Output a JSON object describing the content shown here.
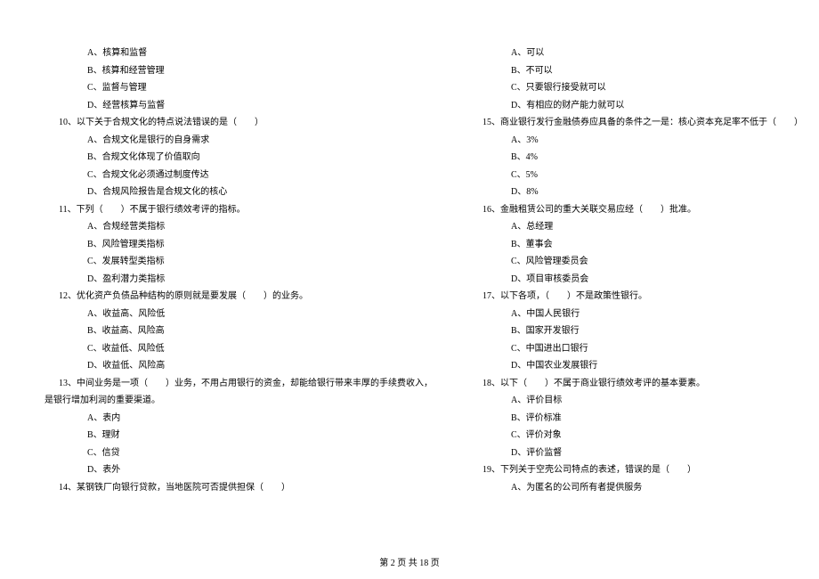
{
  "left": {
    "opts_pre": [
      "A、核算和监督",
      "B、核算和经营管理",
      "C、监督与管理",
      "D、经营核算与监督"
    ],
    "q10": "10、以下关于合规文化的特点说法错误的是（　　）",
    "q10_opts": [
      "A、合规文化是银行的自身需求",
      "B、合规文化体现了价值取向",
      "C、合规文化必须通过制度传达",
      "D、合规风险报告是合规文化的核心"
    ],
    "q11": "11、下列（　　）不属于银行绩效考评的指标。",
    "q11_opts": [
      "A、合规经营类指标",
      "B、风险管理类指标",
      "C、发展转型类指标",
      "D、盈利潜力类指标"
    ],
    "q12": "12、优化资产负债品种结构的原则就是要发展（　　）的业务。",
    "q12_opts": [
      "A、收益高、风险低",
      "B、收益高、风险高",
      "C、收益低、风险低",
      "D、收益低、风险高"
    ],
    "q13_a": "13、中间业务是一项（　　）业务，不用占用银行的资金，却能给银行带来丰厚的手续费收入，",
    "q13_b": "是银行增加利润的重要渠道。",
    "q13_opts": [
      "A、表内",
      "B、理财",
      "C、信贷",
      "D、表外"
    ],
    "q14": "14、某钢铁厂向银行贷款，当地医院可否提供担保（　　）"
  },
  "right": {
    "opts_pre": [
      "A、可以",
      "B、不可以",
      "C、只要银行接受就可以",
      "D、有相应的财产能力就可以"
    ],
    "q15": "15、商业银行发行金融债券应具备的条件之一是：核心资本充足率不低于（　　）",
    "q15_opts": [
      "A、3%",
      "B、4%",
      "C、5%",
      "D、8%"
    ],
    "q16": "16、金融租赁公司的重大关联交易应经（　　）批准。",
    "q16_opts": [
      "A、总经理",
      "B、董事会",
      "C、风险管理委员会",
      "D、项目审核委员会"
    ],
    "q17": "17、以下各项，（　　）不是政策性银行。",
    "q17_opts": [
      "A、中国人民银行",
      "B、国家开发银行",
      "C、中国进出口银行",
      "D、中国农业发展银行"
    ],
    "q18": "18、以下（　　）不属于商业银行绩效考评的基本要素。",
    "q18_opts": [
      "A、评价目标",
      "B、评价标准",
      "C、评价对象",
      "D、评价监督"
    ],
    "q19": "19、下列关于空壳公司特点的表述，错误的是（　　）",
    "q19_opts": [
      "A、为匿名的公司所有者提供服务"
    ]
  },
  "footer": "第 2 页 共 18 页"
}
